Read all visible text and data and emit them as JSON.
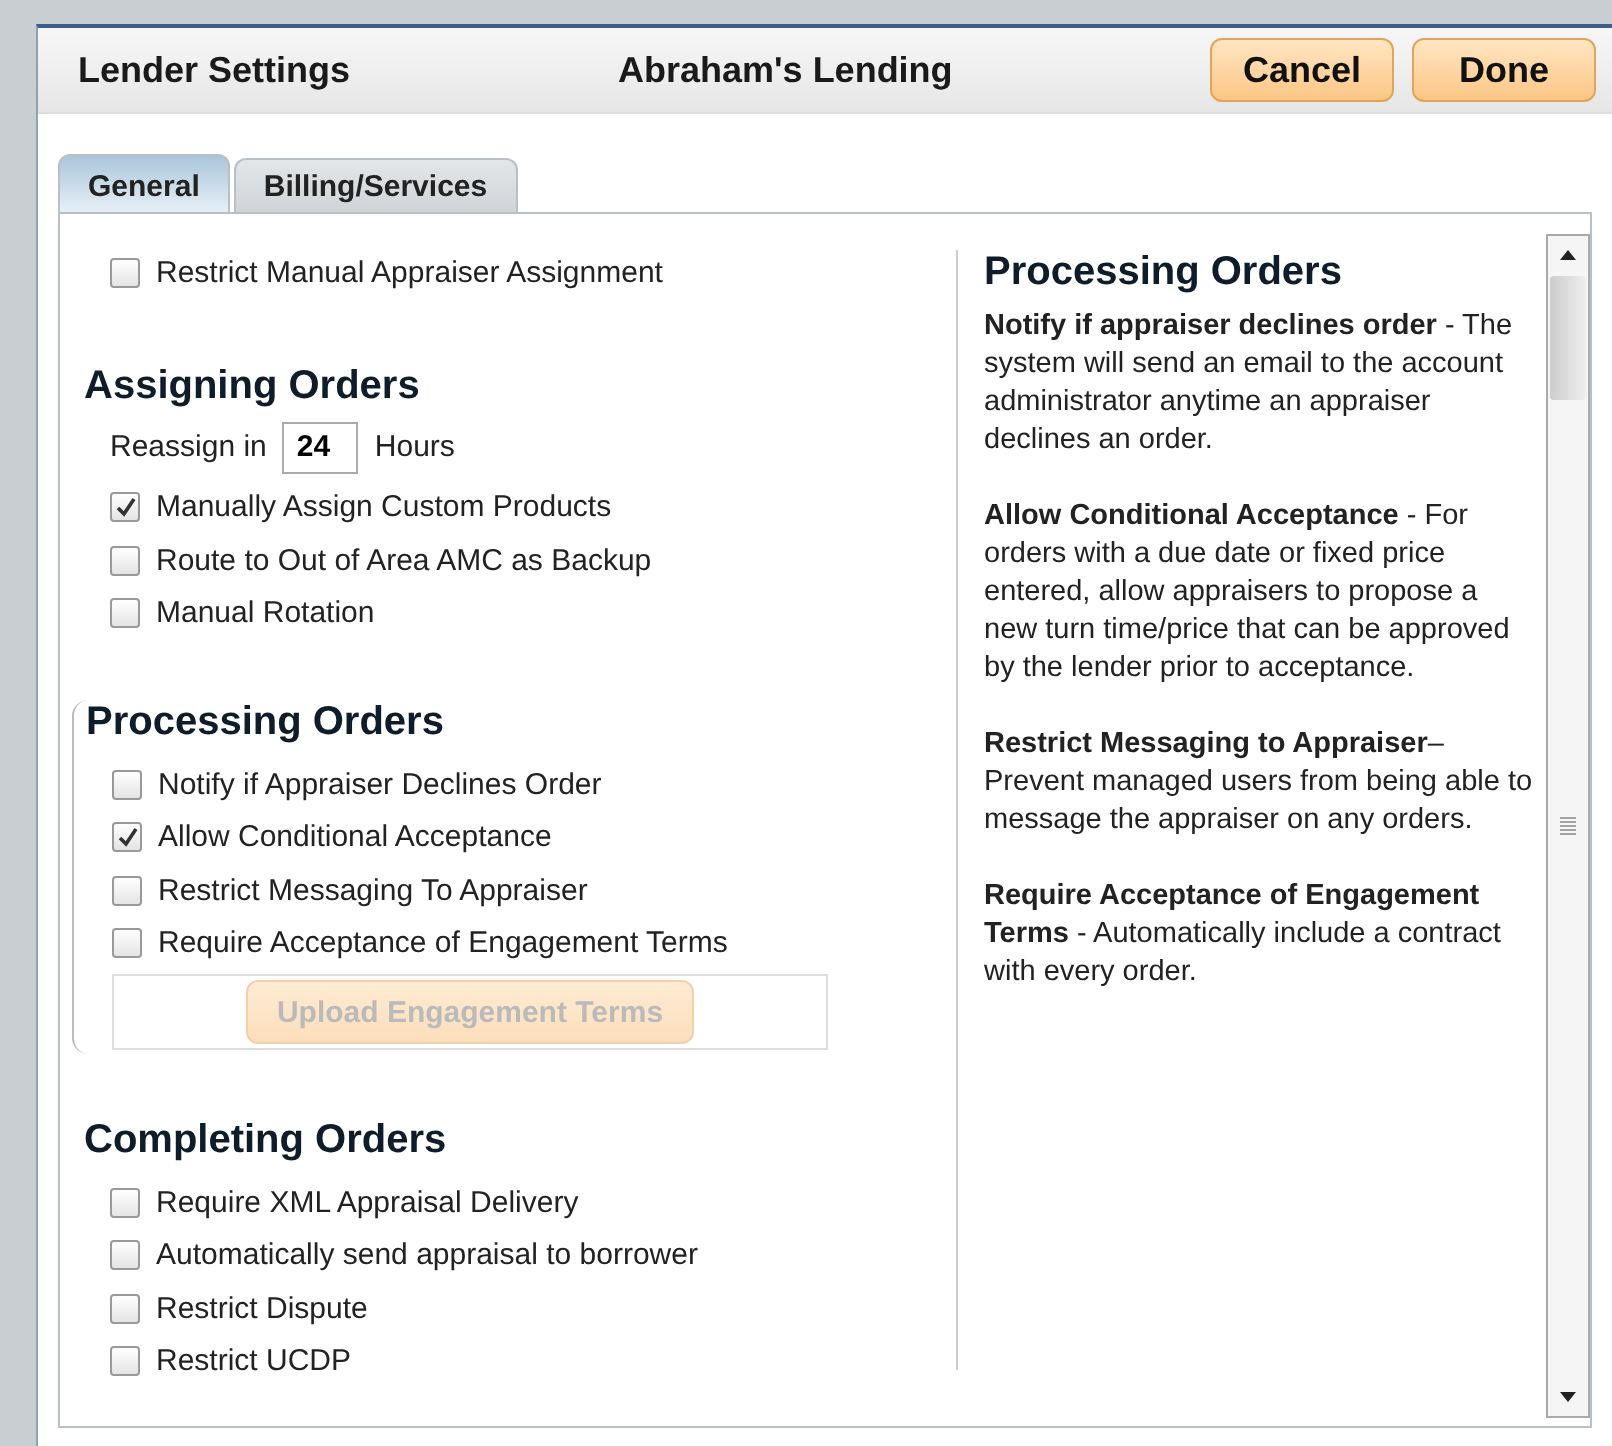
{
  "header": {
    "title": "Lender Settings",
    "lender": "Abraham's Lending",
    "buttons": [
      "Cancel",
      "Done"
    ]
  },
  "tabs": [
    {
      "label": "General",
      "selected": true
    },
    {
      "label": "Billing/Services",
      "selected": false
    }
  ],
  "top_options": [
    {
      "label": "Restrict Manual Appraiser Assignment",
      "checked": false
    }
  ],
  "sections": [
    {
      "title": "Assigning Orders",
      "bracket": false,
      "reassign": {
        "label": "Reassign in",
        "value": "24",
        "unit": "Hours"
      },
      "options": [
        {
          "label": "Manually Assign Custom Products",
          "checked": true
        },
        {
          "label": "Route to Out of Area AMC as Backup",
          "checked": false
        },
        {
          "label": "Manual Rotation",
          "checked": false
        }
      ]
    },
    {
      "title": "Processing Orders",
      "bracket": true,
      "options": [
        {
          "label": "Notify if Appraiser Declines Order",
          "checked": false
        },
        {
          "label": "Allow Conditional Acceptance",
          "checked": true
        },
        {
          "label": "Restrict Messaging To Appraiser",
          "checked": false
        },
        {
          "label": "Require Acceptance of Engagement Terms",
          "checked": false
        }
      ],
      "upload_button": {
        "label": "Upload Engagement Terms",
        "disabled": true
      }
    },
    {
      "title": "Completing Orders",
      "bracket": false,
      "options": [
        {
          "label": "Require XML Appraisal Delivery",
          "checked": false
        },
        {
          "label": "Automatically send appraisal to borrower",
          "checked": false
        },
        {
          "label": "Restrict Dispute",
          "checked": false
        },
        {
          "label": "Restrict UCDP",
          "checked": false
        }
      ]
    }
  ],
  "help": {
    "title": "Processing Orders",
    "paragraphs": [
      "**Notify if appraiser declines order** - The system will send an email to the account administrator anytime an appraiser declines an order.",
      "**Allow Conditional Acceptance** - For orders with a due date or fixed price entered, allow appraisers to propose a new turn time/price that can be approved by the lender prior to acceptance.",
      "**Restrict Messaging to Appraiser**– Prevent managed users from being able to message the appraiser on any orders.",
      "**Require Acceptance of Engagement Terms** - Automatically include a contract with every order."
    ]
  }
}
